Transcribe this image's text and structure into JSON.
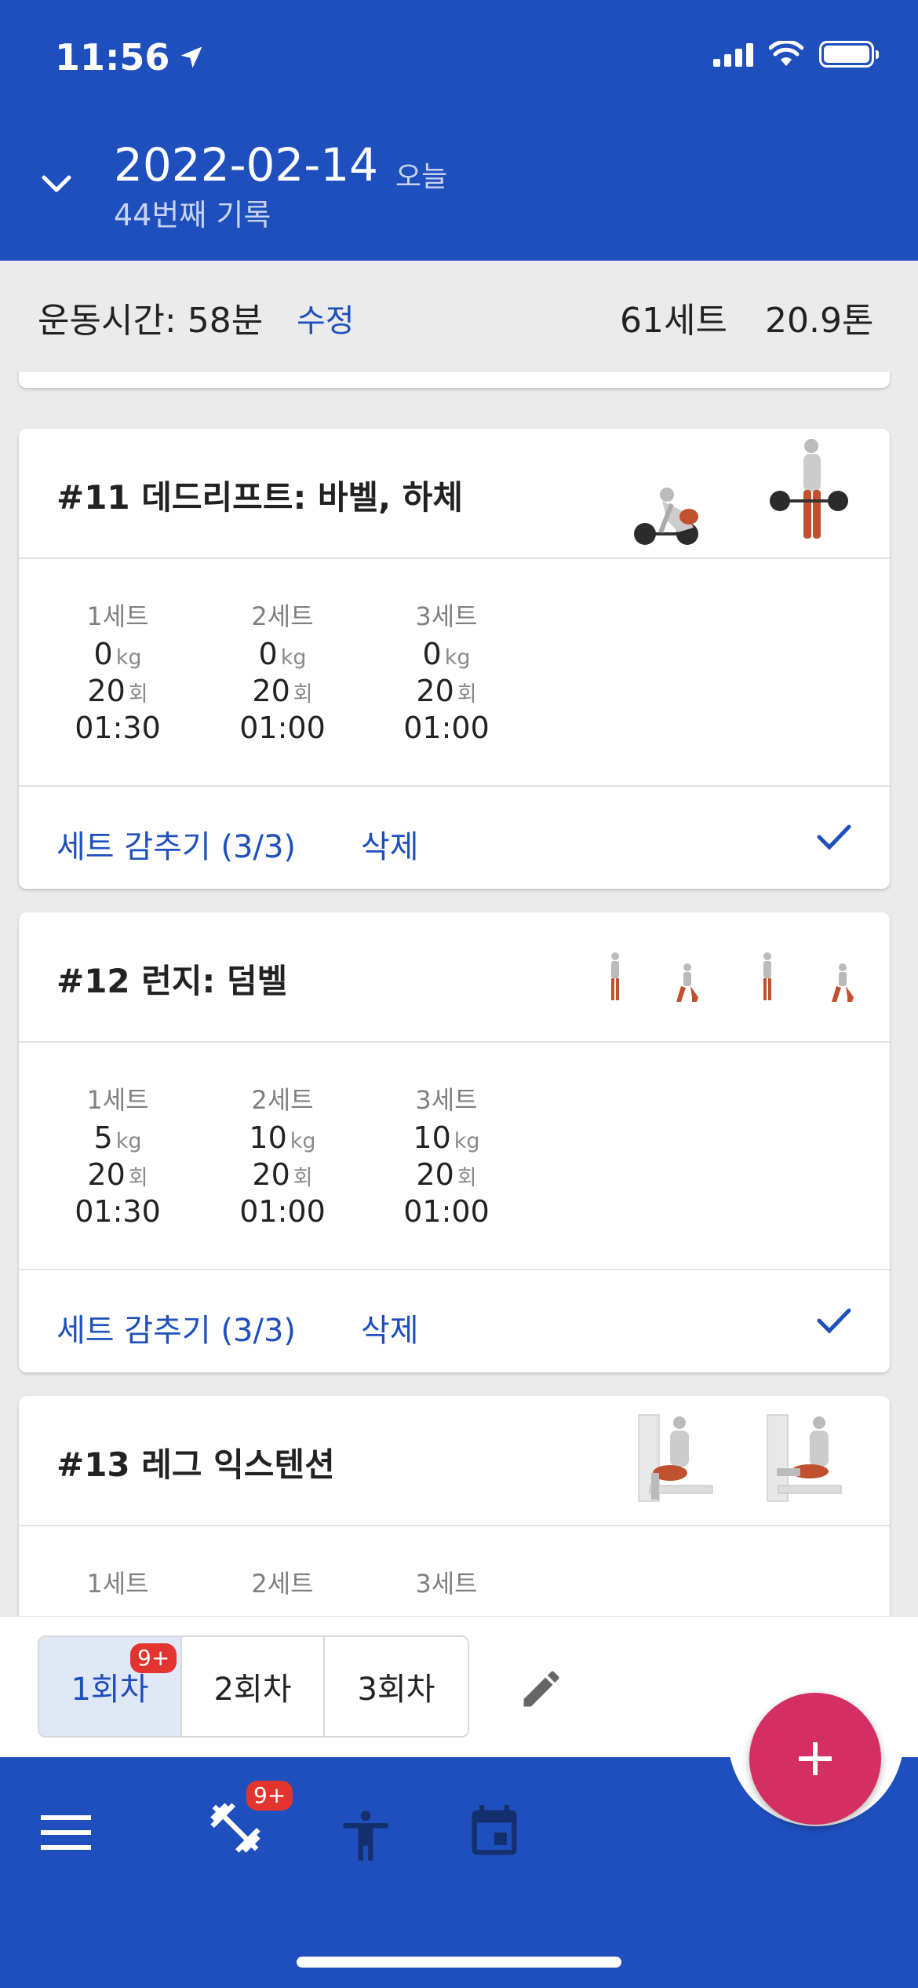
{
  "status_bar": {
    "time": "11:56"
  },
  "header": {
    "date": "2022-02-14",
    "today_label": "오늘",
    "record_label": "44번째 기록"
  },
  "summary": {
    "exercise_time": "운동시간: 58분",
    "edit_label": "수정",
    "total_sets": "61세트",
    "total_weight": "20.9톤"
  },
  "exercises": [
    {
      "title": "#11 데드리프트: 바벨, 하체",
      "sets": [
        {
          "label": "1세트",
          "weight": "0",
          "weight_unit": "kg",
          "reps": "20",
          "reps_unit": "회",
          "rest": "01:30"
        },
        {
          "label": "2세트",
          "weight": "0",
          "weight_unit": "kg",
          "reps": "20",
          "reps_unit": "회",
          "rest": "01:00"
        },
        {
          "label": "3세트",
          "weight": "0",
          "weight_unit": "kg",
          "reps": "20",
          "reps_unit": "회",
          "rest": "01:00"
        }
      ],
      "hide_sets_label": "세트 감추기 (3/3)",
      "delete_label": "삭제",
      "completed": true
    },
    {
      "title": "#12 런지: 덤벨",
      "sets": [
        {
          "label": "1세트",
          "weight": "5",
          "weight_unit": "kg",
          "reps": "20",
          "reps_unit": "회",
          "rest": "01:30"
        },
        {
          "label": "2세트",
          "weight": "10",
          "weight_unit": "kg",
          "reps": "20",
          "reps_unit": "회",
          "rest": "01:00"
        },
        {
          "label": "3세트",
          "weight": "10",
          "weight_unit": "kg",
          "reps": "20",
          "reps_unit": "회",
          "rest": "01:00"
        }
      ],
      "hide_sets_label": "세트 감추기 (3/3)",
      "delete_label": "삭제",
      "completed": true
    },
    {
      "title": "#13 레그 익스텐션",
      "sets": [
        {
          "label": "1세트"
        },
        {
          "label": "2세트"
        },
        {
          "label": "3세트"
        }
      ]
    }
  ],
  "sessions": {
    "tabs": [
      "1회차",
      "2회차",
      "3회차"
    ],
    "active_index": 0,
    "badge": "9+"
  },
  "bottom_nav": {
    "workout_badge": "9+",
    "fab_label": "+"
  },
  "colors": {
    "primary": "#1e4fbd",
    "fab": "#d42f62",
    "badge": "#e4342f"
  }
}
